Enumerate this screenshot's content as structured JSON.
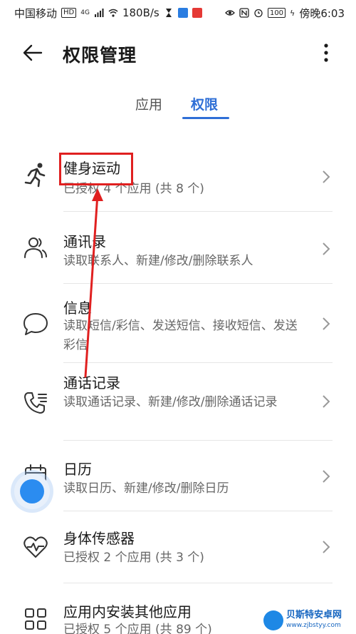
{
  "status_bar": {
    "carrier": "中国移动",
    "hd_badge": "HD",
    "network": "4G",
    "speed": "180B/s",
    "battery": "100",
    "time": "傍晚6:03"
  },
  "header": {
    "title": "权限管理"
  },
  "tabs": [
    {
      "label": "应用",
      "active": false
    },
    {
      "label": "权限",
      "active": true
    }
  ],
  "permissions": [
    {
      "title": "健身运动",
      "subtitle": "已授权 4 个应用 (共 8 个)",
      "icon": "running-person-icon"
    },
    {
      "title": "通讯录",
      "subtitle": "读取联系人、新建/修改/删除联系人",
      "icon": "contacts-icon"
    },
    {
      "title": "信息",
      "subtitle": "读取短信/彩信、发送短信、接收短信、发送彩信",
      "icon": "message-bubble-icon"
    },
    {
      "title": "通话记录",
      "subtitle": "读取通话记录、新建/修改/删除通话记录",
      "icon": "call-log-icon"
    },
    {
      "title": "日历",
      "subtitle": "读取日历、新建/修改/删除日历",
      "icon": "calendar-icon"
    },
    {
      "title": "身体传感器",
      "subtitle": "已授权 2 个应用 (共 3 个)",
      "icon": "heart-rate-icon"
    },
    {
      "title": "应用内安装其他应用",
      "subtitle": "已授权 5 个应用 (共 89 个)",
      "icon": "app-grid-icon"
    }
  ],
  "colors": {
    "accent": "#2f6fd6",
    "annotation": "#e02020",
    "float_ball": "#2b8cf0"
  },
  "watermark": {
    "name": "贝斯特安卓网",
    "url": "www.zjbstyy.com"
  }
}
